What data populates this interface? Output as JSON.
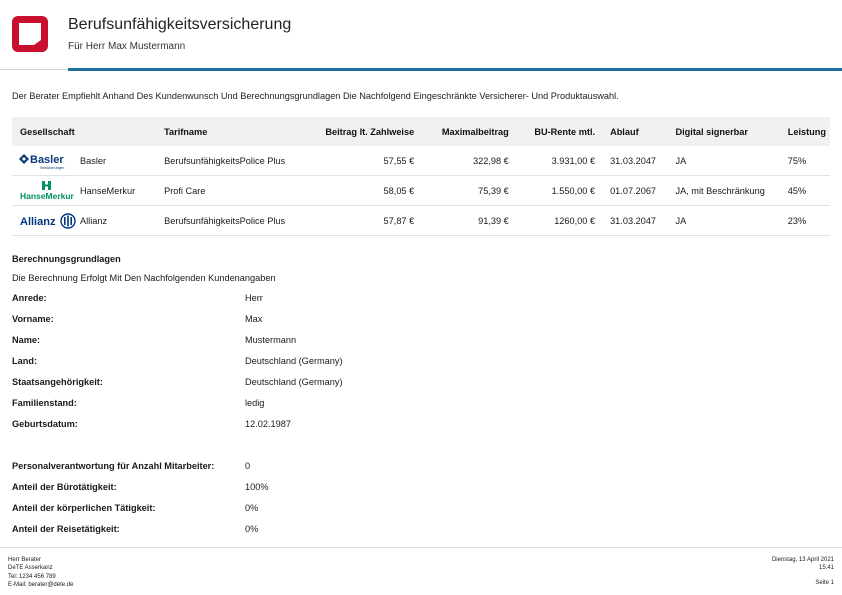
{
  "header": {
    "title": "Berufsunfähigkeitsversicherung",
    "subtitle": "Für Herr Max Mustermann",
    "logo_color": "#c8102e",
    "accent_color": "#1f6f9a"
  },
  "intro": "Der Berater Empfiehlt Anhand Des Kundenwunsch Und Berechnungsgrundlagen Die Nachfolgend Eingeschränkte Versicherer- Und Produktauswahl.",
  "table": {
    "headers": [
      "Gesellschaft",
      "Tarifname",
      "Beitrag lt. Zahlweise",
      "Maximalbeitrag",
      "BU-Rente mtl.",
      "Ablauf",
      "Digital signerbar",
      "Leistung"
    ],
    "rows": [
      {
        "logo": "basler-logo",
        "logo_text": "Basler",
        "logo_subtext": "Versicherungen",
        "gesellschaft": "Basler",
        "tarif": "BerufsunfähigkeitsPolice Plus",
        "beitrag": "57,55 €",
        "max": "322,98 €",
        "rente": "3.931,00 €",
        "ablauf": "31.03.2047",
        "digital": "JA",
        "leistung": "75%"
      },
      {
        "logo": "hansemerkur-logo",
        "logo_text": "HanseMerkur",
        "logo_subtext": "",
        "gesellschaft": "HanseMerkur",
        "tarif": "Profi Care",
        "beitrag": "58,05 €",
        "max": "75,39 €",
        "rente": "1.550,00 €",
        "ablauf": "01.07.2067",
        "digital": "JA, mit Beschränkung",
        "leistung": "45%"
      },
      {
        "logo": "allianz-logo",
        "logo_text": "Allianz",
        "logo_subtext": "",
        "gesellschaft": "Allianz",
        "tarif": "BerufsunfähigkeitsPolice Plus",
        "beitrag": "57,87 €",
        "max": "91,39 €",
        "rente": "1260,00 €",
        "ablauf": "31.03.2047",
        "digital": "JA",
        "leistung": "23%"
      }
    ]
  },
  "grundlagen": {
    "title": "Berechnungsgrundlagen",
    "description": "Die Berechnung Erfolgt Mit Den Nachfolgenden Kundenangaben",
    "personal": [
      {
        "label": "Anrede:",
        "value": "Herr"
      },
      {
        "label": "Vorname:",
        "value": "Max"
      },
      {
        "label": "Name:",
        "value": "Mustermann"
      },
      {
        "label": "Land:",
        "value": "Deutschland (Germany)"
      },
      {
        "label": "Staatsangehörigkeit:",
        "value": "Deutschland (Germany)"
      },
      {
        "label": "Familienstand:",
        "value": "ledig"
      },
      {
        "label": "Geburtsdatum:",
        "value": "12.02.1987"
      }
    ],
    "job": [
      {
        "label": "Personalverantwortung für Anzahl Mitarbeiter:",
        "value": "0"
      },
      {
        "label": "Anteil der Bürotätigkeit:",
        "value": "100%"
      },
      {
        "label": "Anteil der körperlichen Tätigkeit:",
        "value": "0%"
      },
      {
        "label": "Anteil der Reisetätigkeit:",
        "value": "0%"
      }
    ]
  },
  "footer": {
    "left": [
      "Herr Berater",
      "DeTE Asserkanz",
      "Tel: 1234 456 789",
      "E-Mail: berater@dete.de"
    ],
    "right": [
      "Dienstag, 13 April 2021",
      "15:41"
    ],
    "page": "Seite 1"
  }
}
